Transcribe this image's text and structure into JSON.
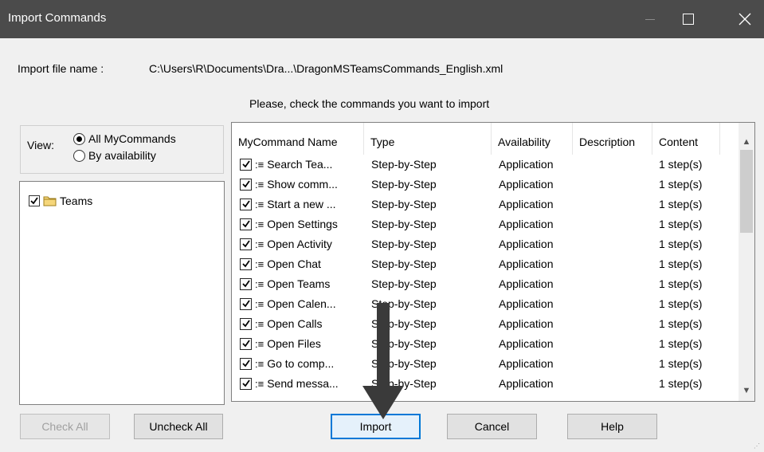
{
  "window": {
    "title": "Import Commands",
    "minimize_icon": "minimize-icon",
    "maximize_icon": "maximize-icon",
    "close_icon": "close-icon"
  },
  "file": {
    "label": "Import file name :",
    "path": "C:\\Users\\R\\Documents\\Dra...\\DragonMSTeamsCommands_English.xml"
  },
  "instruction": "Please, check the commands you want to import",
  "view": {
    "label": "View:",
    "options": [
      {
        "label": "All MyCommands",
        "selected": true
      },
      {
        "label": "By availability",
        "selected": false
      }
    ]
  },
  "tree": {
    "items": [
      {
        "label": "Teams",
        "checked": true,
        "icon": "folder-icon"
      }
    ]
  },
  "grid": {
    "columns": [
      "MyCommand Name",
      "Type",
      "Availability",
      "Description",
      "Content"
    ],
    "rows": [
      {
        "name": "Search Tea...",
        "type": "Step-by-Step",
        "availability": "Application",
        "description": "",
        "content": "1 step(s)",
        "checked": true
      },
      {
        "name": "Show comm...",
        "type": "Step-by-Step",
        "availability": "Application",
        "description": "",
        "content": "1 step(s)",
        "checked": true
      },
      {
        "name": "Start a new ...",
        "type": "Step-by-Step",
        "availability": "Application",
        "description": "",
        "content": "1 step(s)",
        "checked": true
      },
      {
        "name": "Open Settings",
        "type": "Step-by-Step",
        "availability": "Application",
        "description": "",
        "content": "1 step(s)",
        "checked": true
      },
      {
        "name": "Open Activity",
        "type": "Step-by-Step",
        "availability": "Application",
        "description": "",
        "content": "1 step(s)",
        "checked": true
      },
      {
        "name": "Open Chat",
        "type": "Step-by-Step",
        "availability": "Application",
        "description": "",
        "content": "1 step(s)",
        "checked": true
      },
      {
        "name": "Open Teams",
        "type": "Step-by-Step",
        "availability": "Application",
        "description": "",
        "content": "1 step(s)",
        "checked": true
      },
      {
        "name": "Open Calen...",
        "type": "Step-by-Step",
        "availability": "Application",
        "description": "",
        "content": "1 step(s)",
        "checked": true
      },
      {
        "name": "Open Calls",
        "type": "Step-by-Step",
        "availability": "Application",
        "description": "",
        "content": "1 step(s)",
        "checked": true
      },
      {
        "name": "Open Files",
        "type": "Step-by-Step",
        "availability": "Application",
        "description": "",
        "content": "1 step(s)",
        "checked": true
      },
      {
        "name": "Go to comp...",
        "type": "Step-by-Step",
        "availability": "Application",
        "description": "",
        "content": "1 step(s)",
        "checked": true
      },
      {
        "name": "Send messa...",
        "type": "Step-by-Step",
        "availability": "Application",
        "description": "",
        "content": "1 step(s)",
        "checked": true
      }
    ]
  },
  "buttons": {
    "check_all": "Check All",
    "uncheck_all": "Uncheck All",
    "import": "Import",
    "cancel": "Cancel",
    "help": "Help"
  },
  "colors": {
    "titlebar": "#4b4b4b",
    "default_button_border": "#0078d7",
    "annotation_arrow": "#3a3a3a"
  }
}
